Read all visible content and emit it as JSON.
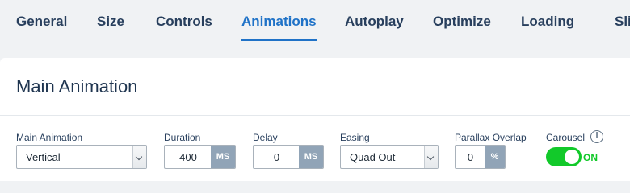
{
  "tabs": [
    {
      "label": "General"
    },
    {
      "label": "Size"
    },
    {
      "label": "Controls"
    },
    {
      "label": "Animations",
      "active": true
    },
    {
      "label": "Autoplay"
    },
    {
      "label": "Optimize"
    },
    {
      "label": "Loading"
    },
    {
      "label": "Slides"
    }
  ],
  "section": {
    "title": "Main Animation"
  },
  "fields": {
    "main_animation": {
      "label": "Main Animation",
      "value": "Vertical"
    },
    "duration": {
      "label": "Duration",
      "value": "400",
      "unit": "MS"
    },
    "delay": {
      "label": "Delay",
      "value": "0",
      "unit": "MS"
    },
    "easing": {
      "label": "Easing",
      "value": "Quad Out"
    },
    "parallax_overlap": {
      "label": "Parallax Overlap",
      "value": "0",
      "unit": "%"
    },
    "carousel": {
      "label": "Carousel",
      "state": "ON"
    }
  },
  "colors": {
    "accent": "#1f72c7",
    "toggle_on": "#12c92a",
    "unit_bg": "#91a4b7"
  }
}
